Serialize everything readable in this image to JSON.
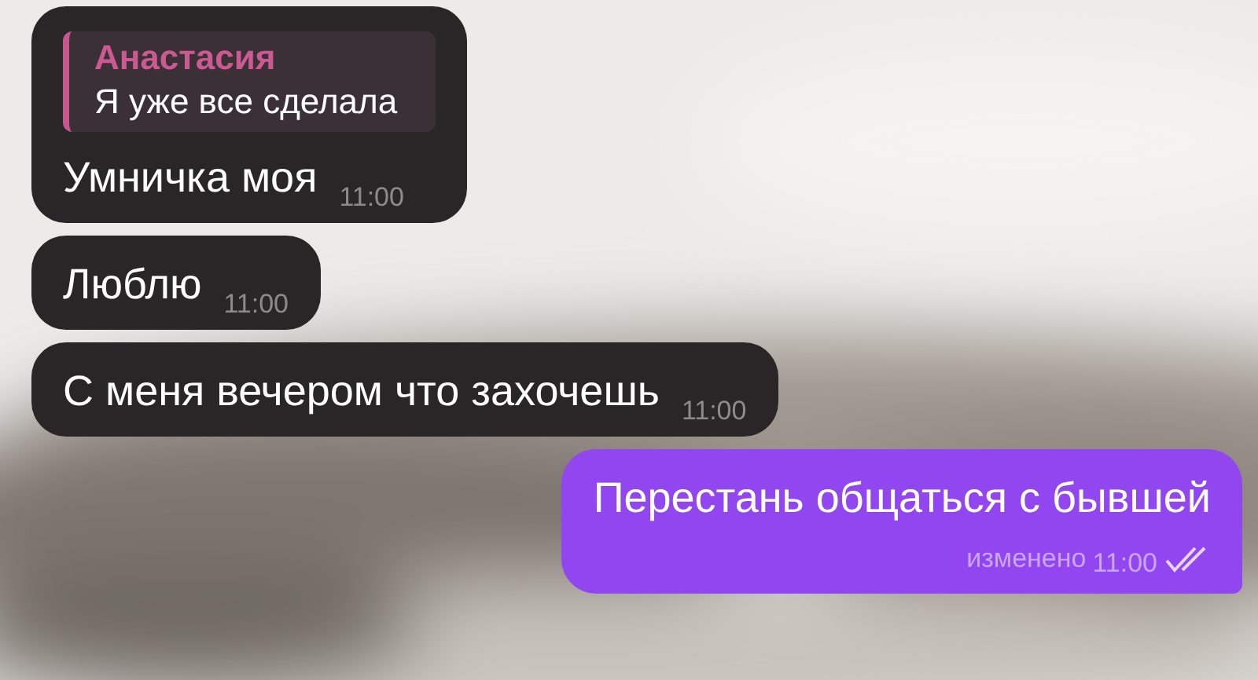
{
  "messages": [
    {
      "kind": "incoming",
      "reply": {
        "author": "Анастасия",
        "text": "Я уже все сделала"
      },
      "text": "Умничка моя",
      "time": "11:00"
    },
    {
      "kind": "incoming",
      "text": "Люблю",
      "time": "11:00"
    },
    {
      "kind": "incoming",
      "text": "С меня вечером что захочешь",
      "time": "11:00"
    },
    {
      "kind": "outgoing",
      "text": "Перестань общаться с бывшей",
      "edited": "изменено",
      "time": "11:00",
      "read": true
    }
  ]
}
